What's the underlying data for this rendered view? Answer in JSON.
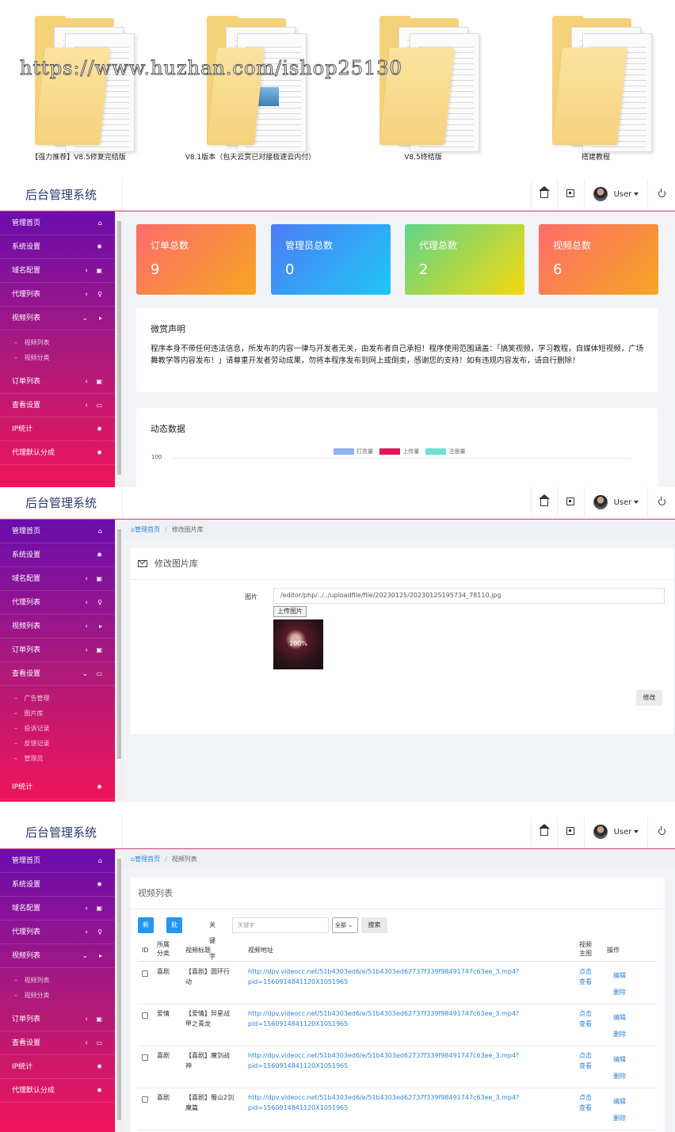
{
  "folders": [
    {
      "label": "【强力推荐】V8.5修复完结版"
    },
    {
      "label": "V8.1版本（包天云赏已对接极速云内付）"
    },
    {
      "label": "V8.5终结版"
    },
    {
      "label": "搭建教程"
    }
  ],
  "watermark": "https://www.huzhan.com/ishop25130",
  "brand": "后台管理系统",
  "user_label": "User",
  "icons": {
    "home": "home-icon",
    "fullscreen": "fullscreen-icon",
    "power": "power-icon"
  },
  "colors": {
    "accent": "#2196f3",
    "sidebar_top": "#6a0dad",
    "sidebar_bottom": "#f0145a"
  },
  "sidebar1": {
    "items": [
      {
        "label": "管理首页",
        "icon": "⌂",
        "chev": ""
      },
      {
        "label": "系统设置",
        "icon": "✹",
        "chev": ""
      },
      {
        "label": "域名配置",
        "icon": "▣",
        "chev": "‹"
      },
      {
        "label": "代理列表",
        "icon": "♀",
        "chev": "‹"
      },
      {
        "label": "视频列表",
        "icon": "▸",
        "chev": "⌄"
      }
    ],
    "sub": [
      "视频列表",
      "视频分类"
    ],
    "items2": [
      {
        "label": "订单列表",
        "icon": "▣",
        "chev": "‹"
      },
      {
        "label": "查看设置",
        "icon": "▭",
        "chev": "‹"
      },
      {
        "label": "IP统计",
        "icon": "✹",
        "chev": ""
      },
      {
        "label": "代理默认分成",
        "icon": "✹",
        "chev": ""
      }
    ]
  },
  "sidebar2": {
    "items": [
      {
        "label": "管理首页",
        "icon": "⌂",
        "chev": ""
      },
      {
        "label": "系统设置",
        "icon": "✹",
        "chev": ""
      },
      {
        "label": "域名配置",
        "icon": "▣",
        "chev": "‹"
      },
      {
        "label": "代理列表",
        "icon": "♀",
        "chev": "‹"
      },
      {
        "label": "视频列表",
        "icon": "▸",
        "chev": "‹"
      },
      {
        "label": "订单列表",
        "icon": "▣",
        "chev": "‹"
      },
      {
        "label": "查看设置",
        "icon": "▭",
        "chev": "⌄"
      }
    ],
    "sub": [
      "广告管理",
      "图片库",
      "投诉记录",
      "反馈记录",
      "管理员"
    ],
    "items2": [
      {
        "label": "IP统计",
        "icon": "✹",
        "chev": ""
      }
    ]
  },
  "dashboard": {
    "stats": [
      {
        "title": "订单总数",
        "value": "9"
      },
      {
        "title": "管理员总数",
        "value": "0"
      },
      {
        "title": "代理总数",
        "value": "2"
      },
      {
        "title": "视频总数",
        "value": "6"
      }
    ],
    "notice_title": "微赏声明",
    "notice_text": "程序本身不带任何违法信息，所发布的内容一律与开发者无关，由发布者自己承担！程序使用范围涵盖：「搞笑视频，学习教程，自媒体短视频，广场舞教学等内容发布！」请尊重开发者劳动成果，勿将本程序发布到网上或倒卖，感谢您的支持！如有违规内容发布，请自行删除！",
    "chart_title": "动态数据",
    "legend": [
      {
        "name": "打赏量",
        "color": "#8fb4f0"
      },
      {
        "name": "上传量",
        "color": "#e0185e"
      },
      {
        "name": "注册量",
        "color": "#6ee0d6"
      }
    ],
    "axis_top": "100"
  },
  "edit": {
    "crumb_home": "管理首页",
    "crumb_current": "修改图片库",
    "title": "修改图片库",
    "field_label": "图片",
    "path_value": "/editor/php/../../uploadfile/file/20230125/20230125195734_78110.jpg",
    "upload_label": "上传图片",
    "progress": "100%",
    "submit_label": "修改"
  },
  "list": {
    "crumb_home": "管理首页",
    "crumb_current": "视频列表",
    "title": "视频列表",
    "btn_new": "新增",
    "btn_batch": "批量新增",
    "kw_label": "关键字",
    "kw_placeholder": "关键字",
    "select_value": "全部",
    "search_label": "搜索",
    "headers": {
      "id": "ID",
      "cat1": "所属",
      "cat2": "分类",
      "title": "视频标题",
      "url": "视频地址",
      "main1": "视频",
      "main2": "主图",
      "ops": "操作"
    },
    "rows": [
      {
        "cat": "喜剧",
        "title1": "【喜剧】圆环行",
        "title2": "动",
        "url1": "http://dpv.videocc.net/51b4303ed6/e/51b4303ed62737f339f98491747c63ee_3.mp4?",
        "url2": "pid=1560914841120X1051965",
        "view1": "点击",
        "view2": "查看",
        "edit": "编辑",
        "del": "删除"
      },
      {
        "cat": "爱情",
        "title1": "【爱情】异星战",
        "title2": "甲之青龙",
        "url1": "http://dpv.videocc.net/51b4303ed6/e/51b4303ed62737f339f98491747c63ee_3.mp4?",
        "url2": "pid=1560914841120X1051965",
        "view1": "点击",
        "view2": "查看",
        "edit": "编辑",
        "del": "删除"
      },
      {
        "cat": "喜剧",
        "title1": "【喜剧】魔剑战",
        "title2": "神",
        "url1": "http://dpv.videocc.net/51b4303ed6/e/51b4303ed62737f339f98491747c63ee_3.mp4?",
        "url2": "pid=1560914841120X1051965",
        "view1": "点击",
        "view2": "查看",
        "edit": "编辑",
        "del": "删除"
      },
      {
        "cat": "喜剧",
        "title1": "【喜剧】蜀山2剑",
        "title2": "魔篇",
        "url1": "http://dpv.videocc.net/51b4303ed6/e/51b4303ed62737f339f98491747c63ee_3.mp4?",
        "url2": "pid=1560914841120X1051965",
        "view1": "点击",
        "view2": "查看",
        "edit": "编辑",
        "del": "删除"
      }
    ]
  }
}
